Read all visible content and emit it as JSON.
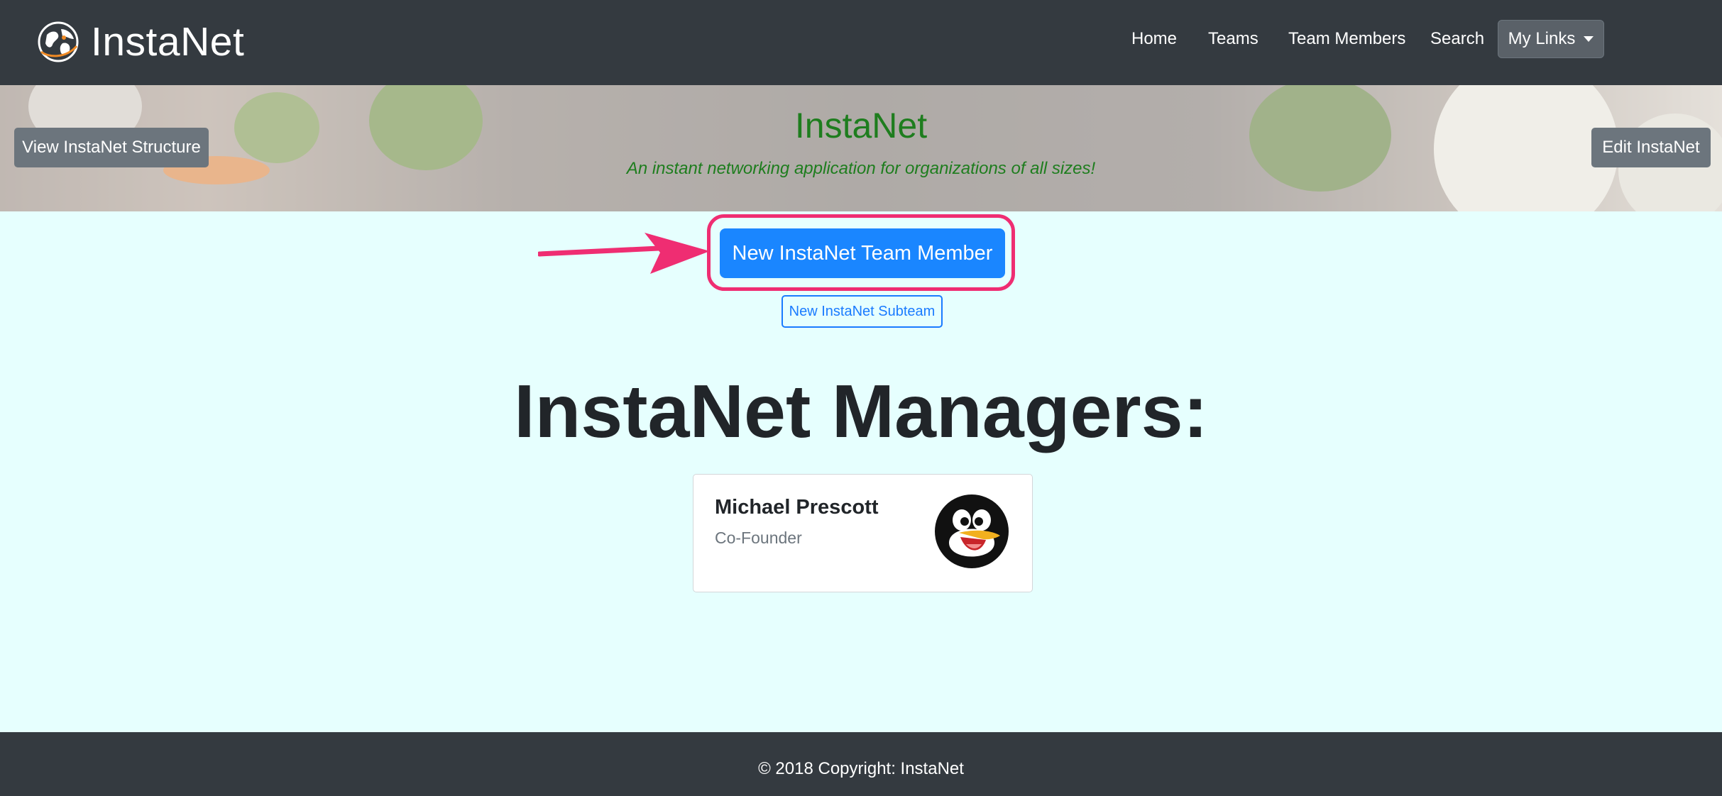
{
  "navbar": {
    "brand": "InstaNet",
    "links": {
      "home": "Home",
      "teams": "Teams",
      "team_members": "Team Members",
      "search": "Search"
    },
    "dropdown_label": "My Links"
  },
  "hero": {
    "title": "InstaNet",
    "tagline": "An instant networking application for organizations of all sizes!",
    "left_button": "View InstaNet Structure",
    "right_button": "Edit InstaNet"
  },
  "actions": {
    "new_member": "New InstaNet Team Member",
    "new_subteam": "New InstaNet Subteam"
  },
  "managers": {
    "heading": "InstaNet Managers:",
    "items": [
      {
        "name": "Michael Prescott",
        "role": "Co-Founder"
      }
    ]
  },
  "footer": {
    "copyright": "© 2018 Copyright: InstaNet"
  },
  "colors": {
    "navbar_bg": "#343a40",
    "page_bg": "#e6fffe",
    "primary": "#1a86ff",
    "secondary": "#6c757d",
    "hero_text": "#1e7d1e",
    "annotation": "#ef2d72"
  }
}
